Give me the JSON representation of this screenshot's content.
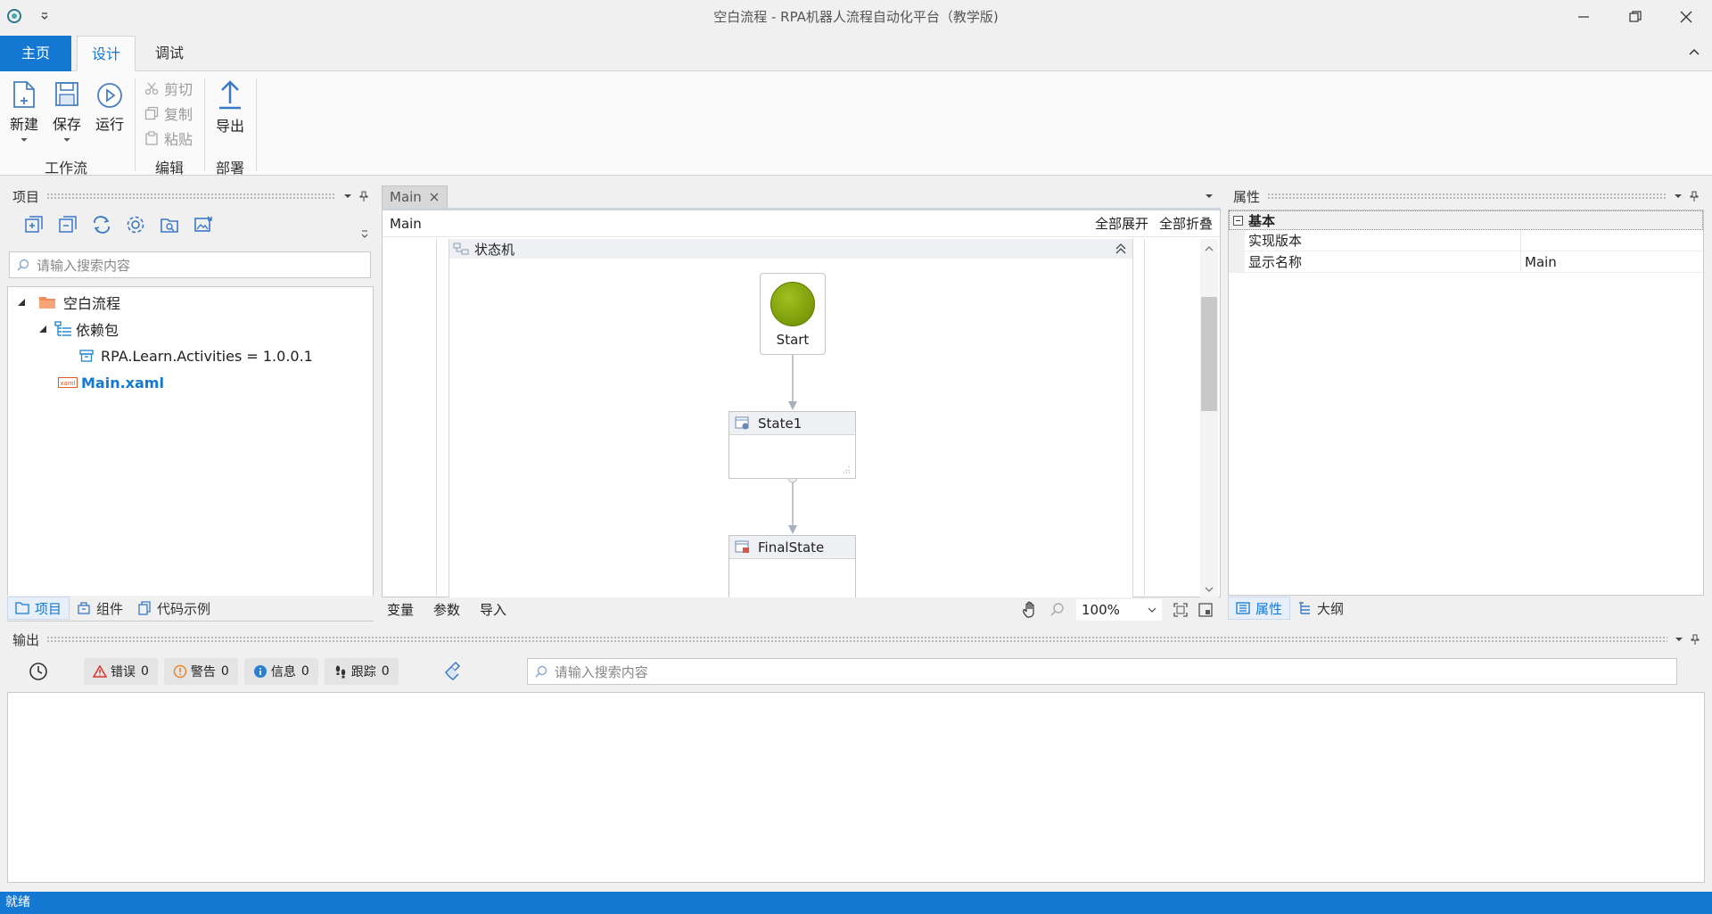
{
  "window": {
    "title": "空白流程 - RPA机器人流程自动化平台（教学版)"
  },
  "tabs": {
    "home": "主页",
    "design": "设计",
    "debug": "调试"
  },
  "ribbon": {
    "new": "新建",
    "save": "保存",
    "run": "运行",
    "workflow_group": "工作流",
    "cut": "剪切",
    "copy": "复制",
    "paste": "粘贴",
    "edit_group": "编辑",
    "export": "导出",
    "deploy_group": "部署"
  },
  "project": {
    "title": "项目",
    "search_placeholder": "请输入搜索内容",
    "tree": {
      "root": "空白流程",
      "deps": "依赖包",
      "dep_item": "RPA.Learn.Activities = 1.0.0.1",
      "main_file": "Main.xaml"
    },
    "bottom_tabs": {
      "project": "项目",
      "components": "组件",
      "code_samples": "代码示例"
    }
  },
  "designer": {
    "doc_tab": "Main",
    "breadcrumb": "Main",
    "expand_all": "全部展开",
    "collapse_all": "全部折叠",
    "state_machine": "状态机",
    "start": "Start",
    "state1": "State1",
    "final_state": "FinalState",
    "bottom": {
      "variables": "变量",
      "arguments": "参数",
      "imports": "导入",
      "zoom": "100%"
    }
  },
  "properties": {
    "title": "属性",
    "category": "基本",
    "rows": [
      {
        "name": "实现版本",
        "value": ""
      },
      {
        "name": "显示名称",
        "value": "Main"
      }
    ],
    "bottom_tabs": {
      "properties": "属性",
      "outline": "大纲"
    }
  },
  "output": {
    "title": "输出",
    "error_label": "错误",
    "error_count": "0",
    "warning_label": "警告",
    "warning_count": "0",
    "info_label": "信息",
    "info_count": "0",
    "trace_label": "跟踪",
    "trace_count": "0",
    "search_placeholder": "请输入搜索内容"
  },
  "status": {
    "text": "就绪"
  },
  "colors": {
    "accent": "#1578d2",
    "start_node": "#7a9a0a"
  }
}
